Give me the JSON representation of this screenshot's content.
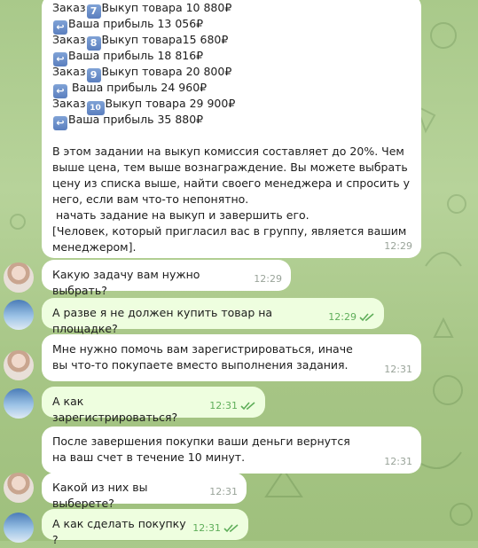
{
  "orders": [
    {
      "num": "7",
      "item": "Выкуп товара 10 880₽",
      "profit": "Ваша прибыль 13 056₽"
    },
    {
      "num": "8",
      "item": "Выкуп товара15 680₽",
      "profit": "Ваша прибыль 18 816₽"
    },
    {
      "num": "9",
      "item": "Выкуп товара  20 800₽",
      "profit": " Ваша прибыль 24 960₽"
    },
    {
      "num": "10",
      "item": "Выкуп товара 29 900₽",
      "profit": "Ваша прибыль  35 880₽"
    }
  ],
  "order_word": "Заказ",
  "first_message": {
    "body": "В этом задании на выкуп комиссия составляет до 20%. Чем выше цена, тем выше вознаграждение. Вы можете выбрать цену из списка выше, найти своего менеджера и спросить у него, если вам что-то непонятно.\n начать задание на выкуп и завершить его.\n[Человек, который пригласил вас в группу, является вашим менеджером].",
    "time": "12:29"
  },
  "messages": [
    {
      "from": "her",
      "text": "Какую задачу вам нужно выбрать?",
      "time": "12:29"
    },
    {
      "from": "me",
      "text": "А разве я не должен купить товар на площадке?",
      "time": "12:29"
    },
    {
      "from": "her",
      "text": "Мне нужно помочь вам зарегистрироваться, иначе вы что-то покупаете вместо выполнения задания.",
      "time": "12:31"
    },
    {
      "from": "me",
      "text": "А как зарегистрироваться?",
      "time": "12:31"
    },
    {
      "from": "her",
      "text": "После завершения покупки ваши деньги вернутся на ваш счет в течение 10 минут.",
      "time": "12:31"
    },
    {
      "from": "her",
      "text": "Какой из них вы выберете?",
      "time": "12:31"
    },
    {
      "from": "me",
      "text": "А как сделать покупку ?",
      "time": "12:31"
    }
  ],
  "icons": {
    "return": "return-arrow-icon",
    "read": "double-check-icon"
  }
}
